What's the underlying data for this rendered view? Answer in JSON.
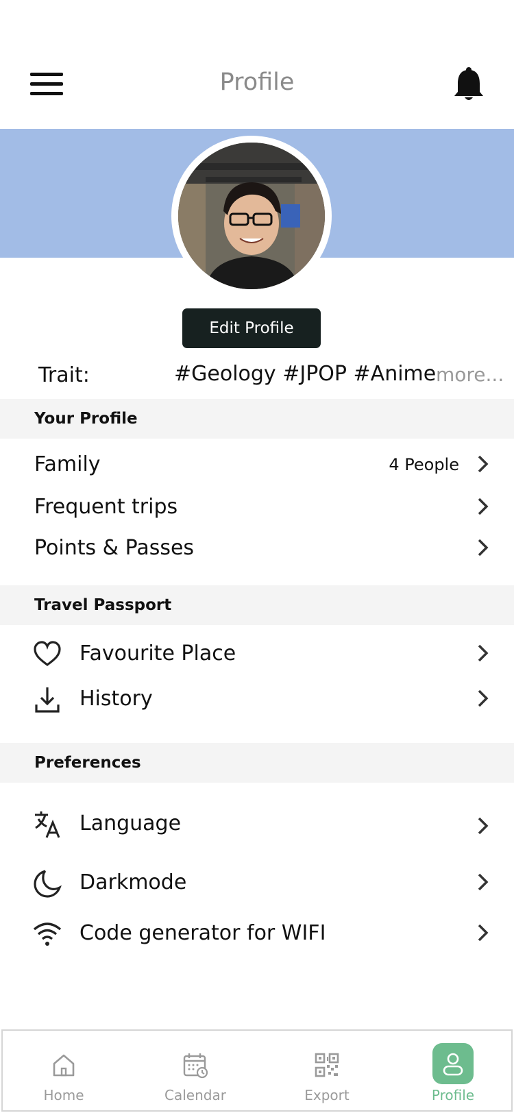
{
  "header": {
    "title": "Profile"
  },
  "profile": {
    "edit_label": "Edit Profile"
  },
  "trait": {
    "label": "Trait:",
    "tags": "#Geology #JPOP #Anime",
    "more": "more..."
  },
  "sections": {
    "your_profile": {
      "title": "Your Profile",
      "items": [
        {
          "label": "Family",
          "value": "4 People"
        },
        {
          "label": "Frequent trips"
        },
        {
          "label": "Points & Passes"
        }
      ]
    },
    "travel_passport": {
      "title": "Travel Passport",
      "items": [
        {
          "label": "Favourite Place",
          "icon": "heart-icon"
        },
        {
          "label": "History",
          "icon": "download-icon"
        }
      ]
    },
    "preferences": {
      "title": "Preferences",
      "items": [
        {
          "label": "Language",
          "icon": "translate-icon"
        },
        {
          "label": "Darkmode",
          "icon": "moon-icon"
        },
        {
          "label": "Code generator for WIFI",
          "icon": "wifi-icon"
        }
      ]
    }
  },
  "nav": {
    "items": [
      {
        "label": "Home",
        "icon": "home-icon"
      },
      {
        "label": "Calendar",
        "icon": "calendar-icon"
      },
      {
        "label": "Export",
        "icon": "qr-code-icon"
      },
      {
        "label": "Profile",
        "icon": "user-icon",
        "active": true
      }
    ]
  },
  "colors": {
    "banner": "#a2bce6",
    "accent": "#6dbc8e",
    "button": "#172120",
    "section_bg": "#f4f4f4"
  }
}
